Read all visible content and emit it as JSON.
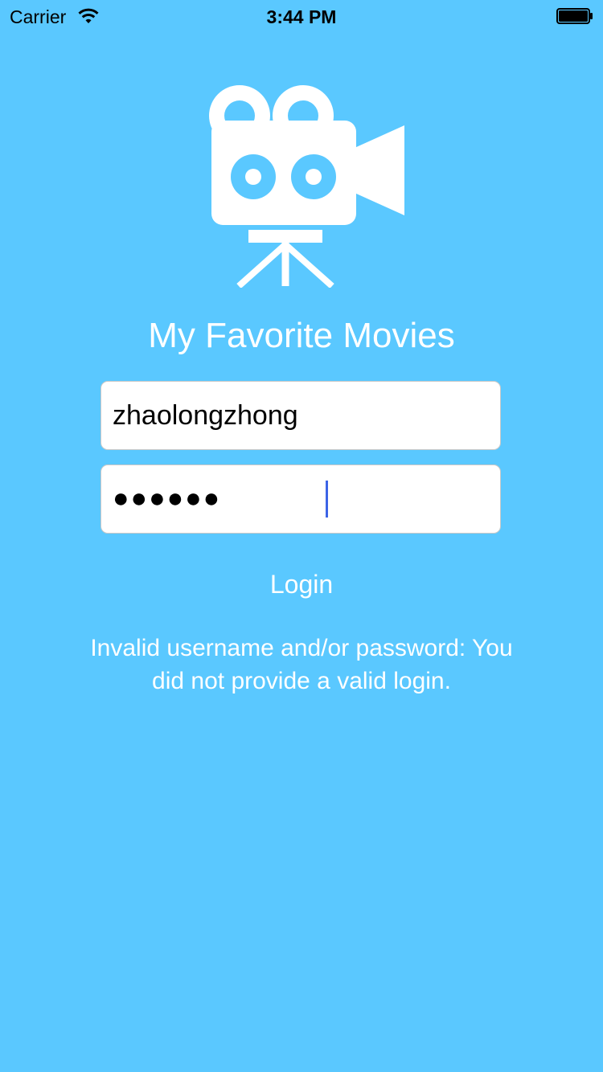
{
  "status_bar": {
    "carrier": "Carrier",
    "time": "3:44 PM",
    "wifi_icon": "wifi-icon",
    "battery_icon": "battery-icon"
  },
  "logo": {
    "icon": "movie-camera-icon",
    "color": "#FFFFFF"
  },
  "app": {
    "title": "My Favorite Movies",
    "background_color": "#5AC8FF"
  },
  "form": {
    "username_value": "zhaolongzhong",
    "password_value": "●●●●●●",
    "login_label": "Login"
  },
  "error": {
    "message": "Invalid username and/or password: You did not provide a valid login."
  }
}
